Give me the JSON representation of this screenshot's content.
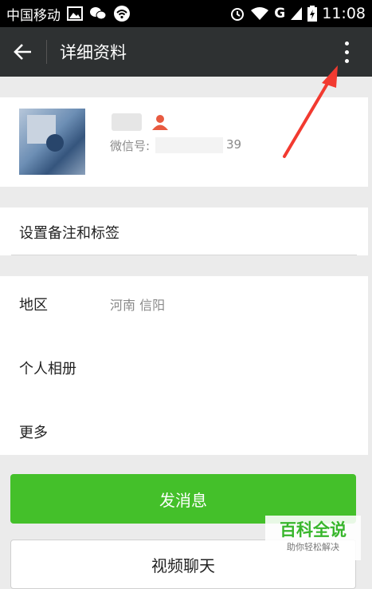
{
  "status_bar": {
    "carrier": "中国移动",
    "network": "G",
    "time": "11:08"
  },
  "title_bar": {
    "title": "详细资料",
    "back_icon": "arrow-left-icon",
    "more_icon": "more-vertical-icon"
  },
  "profile": {
    "wechat_id_prefix": "微信号:",
    "wechat_id_suffix": "39"
  },
  "remark": {
    "label": "设置备注和标签"
  },
  "info": {
    "region_label": "地区",
    "region_value": "河南  信阳",
    "album_label": "个人相册",
    "more_label": "更多"
  },
  "actions": {
    "send_message": "发消息",
    "video_call": "视频聊天"
  },
  "watermark": {
    "title": "百科全说",
    "subtitle": "助你轻松解决"
  },
  "colors": {
    "title_bar": "#2e3132",
    "primary_green": "#44c02a",
    "annotation_red": "#f23a30"
  }
}
